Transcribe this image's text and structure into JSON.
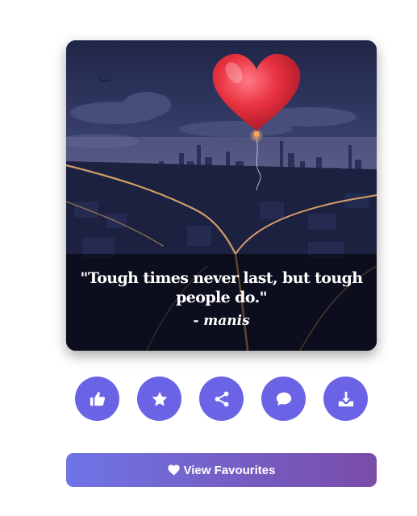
{
  "quote_card": {
    "image_subject": "red heart balloon over night city",
    "quote_text": "\"Tough times never last, but tough people do.\"",
    "author": "- manis"
  },
  "actions": [
    {
      "name": "like-button",
      "icon": "thumbs-up-icon"
    },
    {
      "name": "favourite-button",
      "icon": "star-icon"
    },
    {
      "name": "share-button",
      "icon": "share-icon"
    },
    {
      "name": "comment-button",
      "icon": "comment-icon"
    },
    {
      "name": "download-button",
      "icon": "download-icon"
    }
  ],
  "favourites_button": {
    "label": "View Favourites",
    "icon": "heart-icon"
  },
  "colors": {
    "action_bg": "#6a63e6",
    "gradient_start": "#6f74e6",
    "gradient_end": "#7a4ca8",
    "heart_balloon": "#e0283c"
  }
}
